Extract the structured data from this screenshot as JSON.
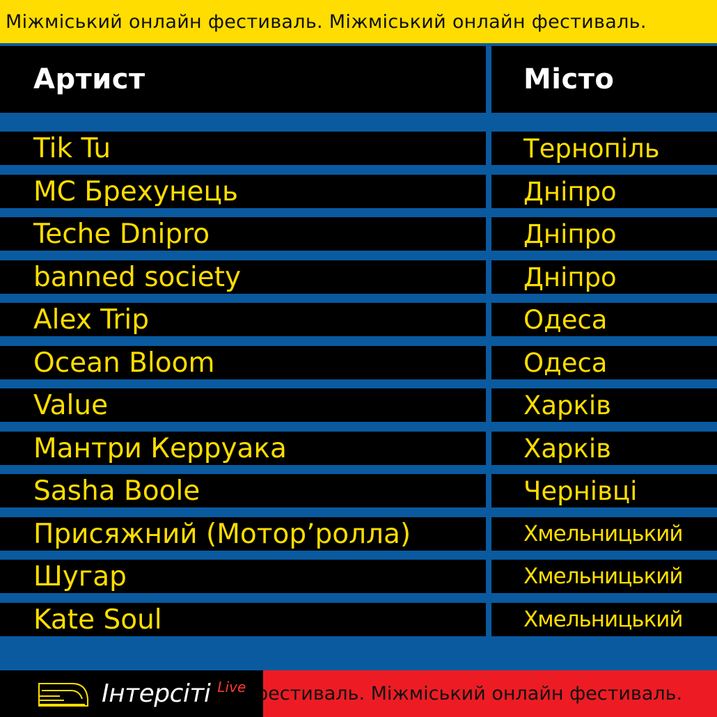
{
  "ticker": {
    "top_text": "Міжміський онлайн фестиваль. Міжміський онлайн фестиваль.",
    "bottom_text": "фестиваль. Міжміський онлайн фестиваль."
  },
  "table": {
    "headers": {
      "artist": "Артист",
      "city": "Місто"
    },
    "rows": [
      {
        "artist": "Tik Tu",
        "city": "Тернопіль"
      },
      {
        "artist": "MC Брехунець",
        "city": "Дніпро"
      },
      {
        "artist": "Teche Dnipro",
        "city": "Дніпро"
      },
      {
        "artist": "banned society",
        "city": "Дніпро"
      },
      {
        "artist": "Alex Trip",
        "city": "Одеса"
      },
      {
        "artist": "Ocean Bloom",
        "city": "Одеса"
      },
      {
        "artist": "Value",
        "city": "Харків"
      },
      {
        "artist": "Мантри Керруака",
        "city": "Харків"
      },
      {
        "artist": "Sasha Boole",
        "city": "Чернівці"
      },
      {
        "artist": "Присяжний (Мотор’ролла)",
        "city": "Хмельницький"
      },
      {
        "artist": "Шугар",
        "city": "Хмельницький"
      },
      {
        "artist": "Kate Soul",
        "city": "Хмельницький"
      }
    ]
  },
  "brand": {
    "name": "Інтерсіті",
    "tag": "Live",
    "icon": "train-icon"
  },
  "colors": {
    "yellow": "#ffdd00",
    "blue": "#0a5aa0",
    "red": "#ed1c24",
    "black": "#000000"
  }
}
